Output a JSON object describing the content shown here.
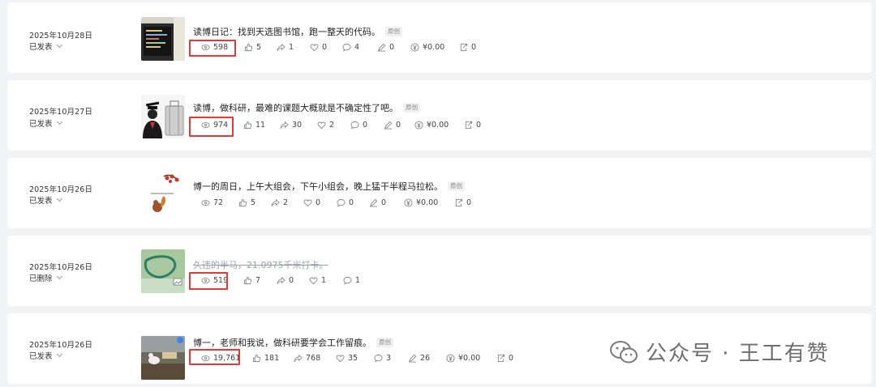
{
  "posts": [
    {
      "date": "2025年10月28日",
      "status": "已发表",
      "title": "读博日记：找到天选图书馆，跑一整天的代码。",
      "badge": "原创",
      "views": "598",
      "likes": "5",
      "shares": "1",
      "favs": "0",
      "comments": "4",
      "notes": "0",
      "money": "¥0.00",
      "out": "0"
    },
    {
      "date": "2025年10月27日",
      "status": "已发表",
      "title": "读博，做科研，最难的课题大概就是不确定性了吧。",
      "badge": "原创",
      "views": "974",
      "likes": "11",
      "shares": "30",
      "favs": "2",
      "comments": "0",
      "notes": "0",
      "money": "¥0.00",
      "out": "0"
    },
    {
      "date": "2025年10月26日",
      "status": "已发表",
      "title": "博一的周日，上午大组会，下午小组会，晚上猛干半程马拉松。",
      "badge": "原创",
      "views": "72",
      "likes": "5",
      "shares": "2",
      "favs": "0",
      "comments": "0",
      "notes": "0",
      "money": "¥0.00",
      "out": "0"
    },
    {
      "date": "2025年10月26日",
      "status": "已删除",
      "title": "久违的半马，21.0975千米打卡。",
      "views": "519",
      "likes": "7",
      "shares": "0",
      "favs": "1",
      "comments": "1"
    },
    {
      "date": "2025年10月26日",
      "status": "已发表",
      "title": "博一，老师和我说，做科研要学会工作留痕。",
      "badge": "原创",
      "views": "19,761",
      "likes": "181",
      "shares": "768",
      "favs": "35",
      "comments": "3",
      "notes": "26",
      "money": "¥0.00",
      "out": "0"
    }
  ],
  "watermark": {
    "text": "公众号 · 王工有赞"
  },
  "icons": {
    "views": "eye-icon",
    "likes": "thumbs-up-icon",
    "shares": "share-icon",
    "favs": "heart-icon",
    "comments": "comment-icon",
    "notes": "pen-icon",
    "money": "yen-icon",
    "out": "export-icon"
  },
  "colors": {
    "highlight": "#e53935",
    "background": "#f2f3f5"
  }
}
